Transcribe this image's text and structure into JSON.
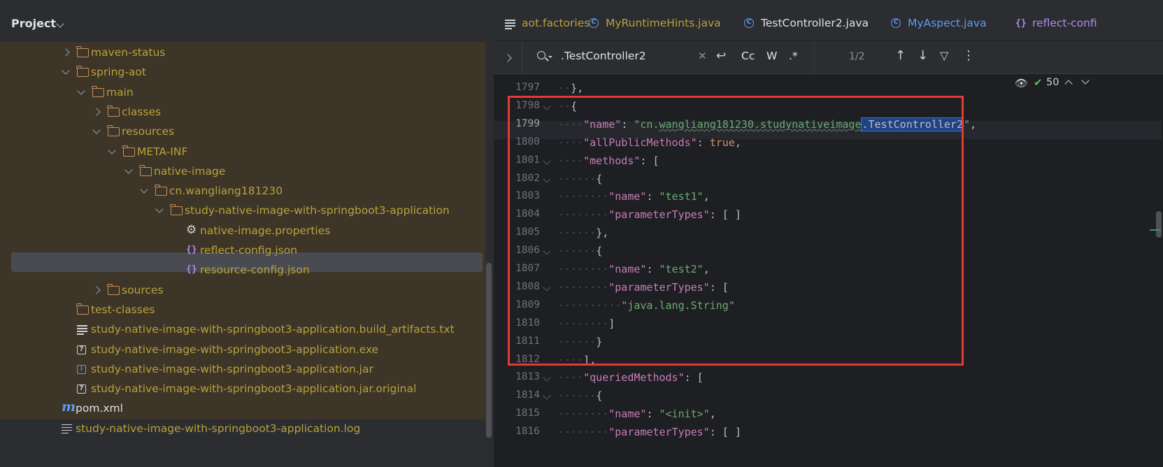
{
  "project_panel": {
    "title": "Project",
    "tree": [
      {
        "label": "maven-status",
        "icon": "folder-icon",
        "expand": "collapsed"
      },
      {
        "label": "spring-aot",
        "icon": "folder-icon",
        "expand": "expanded"
      },
      {
        "label": "main",
        "icon": "folder-icon",
        "expand": "expanded"
      },
      {
        "label": "classes",
        "icon": "folder-icon",
        "expand": "collapsed"
      },
      {
        "label": "resources",
        "icon": "folder-icon",
        "expand": "expanded"
      },
      {
        "label": "META-INF",
        "icon": "folder-icon",
        "expand": "expanded"
      },
      {
        "label": "native-image",
        "icon": "folder-icon",
        "expand": "expanded"
      },
      {
        "label": "cn.wangliang181230",
        "icon": "folder-icon",
        "expand": "expanded"
      },
      {
        "label": "study-native-image-with-springboot3-application",
        "icon": "folder-icon",
        "expand": "expanded"
      },
      {
        "label": "native-image.properties",
        "icon": "gear-icon",
        "expand": "none"
      },
      {
        "label": "reflect-config.json",
        "icon": "json-icon",
        "expand": "none",
        "selected": true
      },
      {
        "label": "resource-config.json",
        "icon": "json-icon",
        "expand": "none"
      },
      {
        "label": "sources",
        "icon": "folder-icon",
        "expand": "collapsed"
      },
      {
        "label": "test-classes",
        "icon": "folder-icon",
        "expand": "none"
      },
      {
        "label": "study-native-image-with-springboot3-application.build_artifacts.txt",
        "icon": "text-file-icon",
        "expand": "none"
      },
      {
        "label": "study-native-image-with-springboot3-application.exe",
        "icon": "unknown-file-icon",
        "expand": "none"
      },
      {
        "label": "study-native-image-with-springboot3-application.jar",
        "icon": "jar-icon",
        "expand": "none"
      },
      {
        "label": "study-native-image-with-springboot3-application.jar.original",
        "icon": "unknown-file-icon",
        "expand": "none"
      },
      {
        "label": "pom.xml",
        "icon": "maven-icon",
        "expand": "none"
      },
      {
        "label": "study-native-image-with-springboot3-application.log",
        "icon": "text-file-icon",
        "expand": "none"
      }
    ]
  },
  "tabs": [
    {
      "label": "aot.factories",
      "icon": "text-file-icon"
    },
    {
      "label": "MyRuntimeHints.java",
      "icon": "class-icon"
    },
    {
      "label": "TestController2.java",
      "icon": "class-icon"
    },
    {
      "label": "MyAspect.java",
      "icon": "class-icon"
    },
    {
      "label": "reflect-confi",
      "icon": "json-icon",
      "active": true
    }
  ],
  "find": {
    "query": ".TestController2",
    "count": "1/2",
    "case_label": "Cc",
    "word_label": "W",
    "regex_label": ".*"
  },
  "inspection": {
    "count": "50"
  },
  "code": {
    "lines": [
      {
        "n": "1797",
        "text": "  },"
      },
      {
        "n": "1798",
        "text": "  {"
      },
      {
        "n": "1799",
        "text": "    \"name\": \"cn.wangliang181230.studynativeimage.TestController2\","
      },
      {
        "n": "1800",
        "text": "    \"allPublicMethods\": true,"
      },
      {
        "n": "1801",
        "text": "    \"methods\": ["
      },
      {
        "n": "1802",
        "text": "      {"
      },
      {
        "n": "1803",
        "text": "        \"name\": \"test1\","
      },
      {
        "n": "1804",
        "text": "        \"parameterTypes\": [ ]"
      },
      {
        "n": "1805",
        "text": "      },"
      },
      {
        "n": "1806",
        "text": "      {"
      },
      {
        "n": "1807",
        "text": "        \"name\": \"test2\","
      },
      {
        "n": "1808",
        "text": "        \"parameterTypes\": ["
      },
      {
        "n": "1809",
        "text": "          \"java.lang.String\""
      },
      {
        "n": "1810",
        "text": "        ]"
      },
      {
        "n": "1811",
        "text": "      }"
      },
      {
        "n": "1812",
        "text": "    ],"
      },
      {
        "n": "1813",
        "text": "    \"queriedMethods\": ["
      },
      {
        "n": "1814",
        "text": "      {"
      },
      {
        "n": "1815",
        "text": "        \"name\": \"<init>\","
      },
      {
        "n": "1816",
        "text": "        \"parameterTypes\": [ ]"
      }
    ]
  },
  "colors": {
    "accent": "#3574f0",
    "highlight_box": "#e53935",
    "folder": "#c98f5e",
    "json_icon": "#b189f5",
    "string": "#6aab73",
    "key_keyword": "#c77dbb",
    "boolean": "#cf8e6d",
    "olive_label": "#b8a23c"
  }
}
